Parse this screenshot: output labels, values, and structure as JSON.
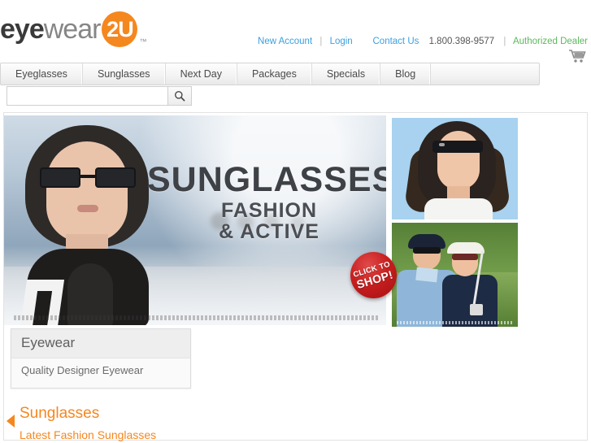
{
  "brand": {
    "name_part1": "eye",
    "name_part2": "wear",
    "badge": "2U",
    "tm": "™"
  },
  "header": {
    "links": [
      {
        "label": "New Account",
        "color": "#3a9fe0"
      },
      {
        "label": "Login",
        "color": "#3a9fe0"
      },
      {
        "label": "Contact Us",
        "color": "#3a9fe0"
      }
    ],
    "separator": "|",
    "phone": "1.800.398-9577",
    "dealer": "Authorized Dealer",
    "cart_icon": "shopping-cart-icon"
  },
  "nav": {
    "items": [
      {
        "label": "Eyeglasses"
      },
      {
        "label": "Sunglasses"
      },
      {
        "label": "Next Day"
      },
      {
        "label": "Packages"
      },
      {
        "label": "Specials"
      },
      {
        "label": "Blog"
      }
    ]
  },
  "search": {
    "value": "",
    "placeholder": "",
    "icon": "search-icon"
  },
  "hero": {
    "title_line1": "SUNGLASSES",
    "title_line2": "FASHION",
    "title_line3": "& ACTIVE",
    "badge_line1": "CLICK TO",
    "badge_line2": "SHOP!",
    "photo_top_alt": "woman-wearing-sunglasses-photo",
    "photo_bottom_alt": "golf-couple-wearing-sunglasses-photo",
    "main_photo_alt": "woman-in-black-scarf-sunglasses-photo"
  },
  "callout": {
    "title": "Eyewear",
    "subtitle": "Quality Designer Eyewear"
  },
  "section": {
    "title": "Sunglasses",
    "subtitle": "Latest Fashion Sunglasses",
    "accent": "#f5871f"
  },
  "colors": {
    "brand_orange": "#f5871f",
    "link_blue": "#3a9fe0",
    "dealer_green": "#5cb85c",
    "badge_red": "#c81f1f"
  }
}
